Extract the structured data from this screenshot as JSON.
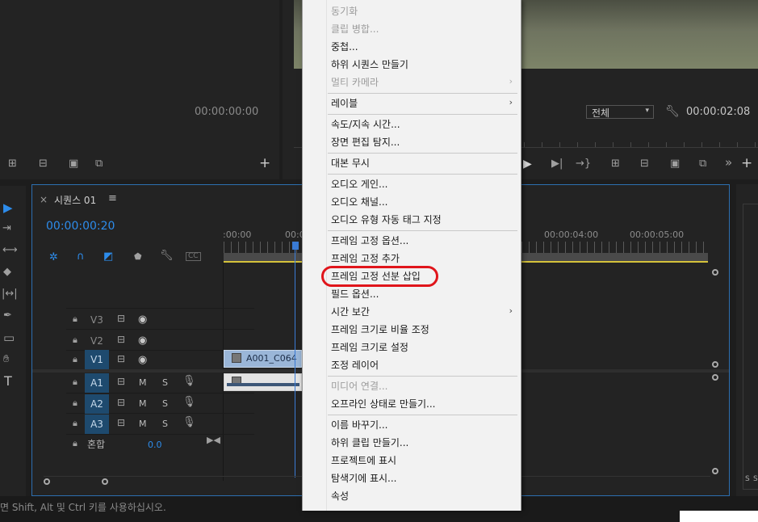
{
  "source_monitor": {
    "timecode": "00:00:00:00"
  },
  "program_monitor": {
    "zoom_select": "전체",
    "timecode": "00:00:02:08"
  },
  "sequence": {
    "tab_close": "×",
    "title": "시퀀스 01",
    "menu_glyph": "≡",
    "timecode": "00:00:00:20",
    "ruler_labels": [
      ":00:00",
      "00:0",
      "00:00:04:00",
      "00:00:05:00"
    ],
    "tracks": {
      "v3": "V3",
      "v2": "V2",
      "v1": "V1",
      "v1_source": "V1",
      "a1": "A1",
      "a2": "A2",
      "a3": "A3",
      "a1_source": "A1",
      "a2_source": "A2",
      "a3_source": "A3",
      "mute": "M",
      "solo": "S"
    },
    "mix_label": "혼합",
    "mix_value": "0.0",
    "clip_name": "A001_C064"
  },
  "right_panel": {
    "labels": [
      "S",
      "S"
    ]
  },
  "status_bar": {
    "text": "면 Shift, Alt 및 Ctrl 키를 사용하십시오."
  },
  "context_menu": {
    "items": [
      {
        "label": "동기화",
        "disabled": true
      },
      {
        "label": "클립 병합...",
        "disabled": true
      },
      {
        "label": "중첩..."
      },
      {
        "label": "하위 시퀀스 만들기"
      },
      {
        "label": "멀티 카메라",
        "disabled": true,
        "submenu": true
      },
      {
        "label": "레이블",
        "submenu": true
      },
      {
        "label": "속도/지속 시간..."
      },
      {
        "label": "장면 편집 탐지..."
      },
      {
        "label": "대본 무시"
      },
      {
        "label": "오디오 게인..."
      },
      {
        "label": "오디오 채널..."
      },
      {
        "label": "오디오 유형 자동 태그 지정"
      },
      {
        "label": "프레임 고정 옵션..."
      },
      {
        "label": "프레임 고정 추가"
      },
      {
        "label": "프레임 고정 선분 삽입",
        "highlighted": true
      },
      {
        "label": "필드 옵션..."
      },
      {
        "label": "시간 보간",
        "submenu": true
      },
      {
        "label": "프레임 크기로 비율 조정"
      },
      {
        "label": "프레임 크기로 설정"
      },
      {
        "label": "조정 레이어"
      },
      {
        "label": "미디어 연결...",
        "disabled": true
      },
      {
        "label": "오프라인 상태로 만들기..."
      },
      {
        "label": "이름 바꾸기..."
      },
      {
        "label": "하위 클립 만들기..."
      },
      {
        "label": "프로젝트에 표시"
      },
      {
        "label": "탐색기에 표시..."
      },
      {
        "label": "속성"
      }
    ],
    "submenu_glyph": "›",
    "highlight_color": "#e0151b"
  },
  "colors": {
    "accent": "#2d8ceb",
    "selection": "#1e4a6e",
    "playhead": "#3a7bd5"
  }
}
